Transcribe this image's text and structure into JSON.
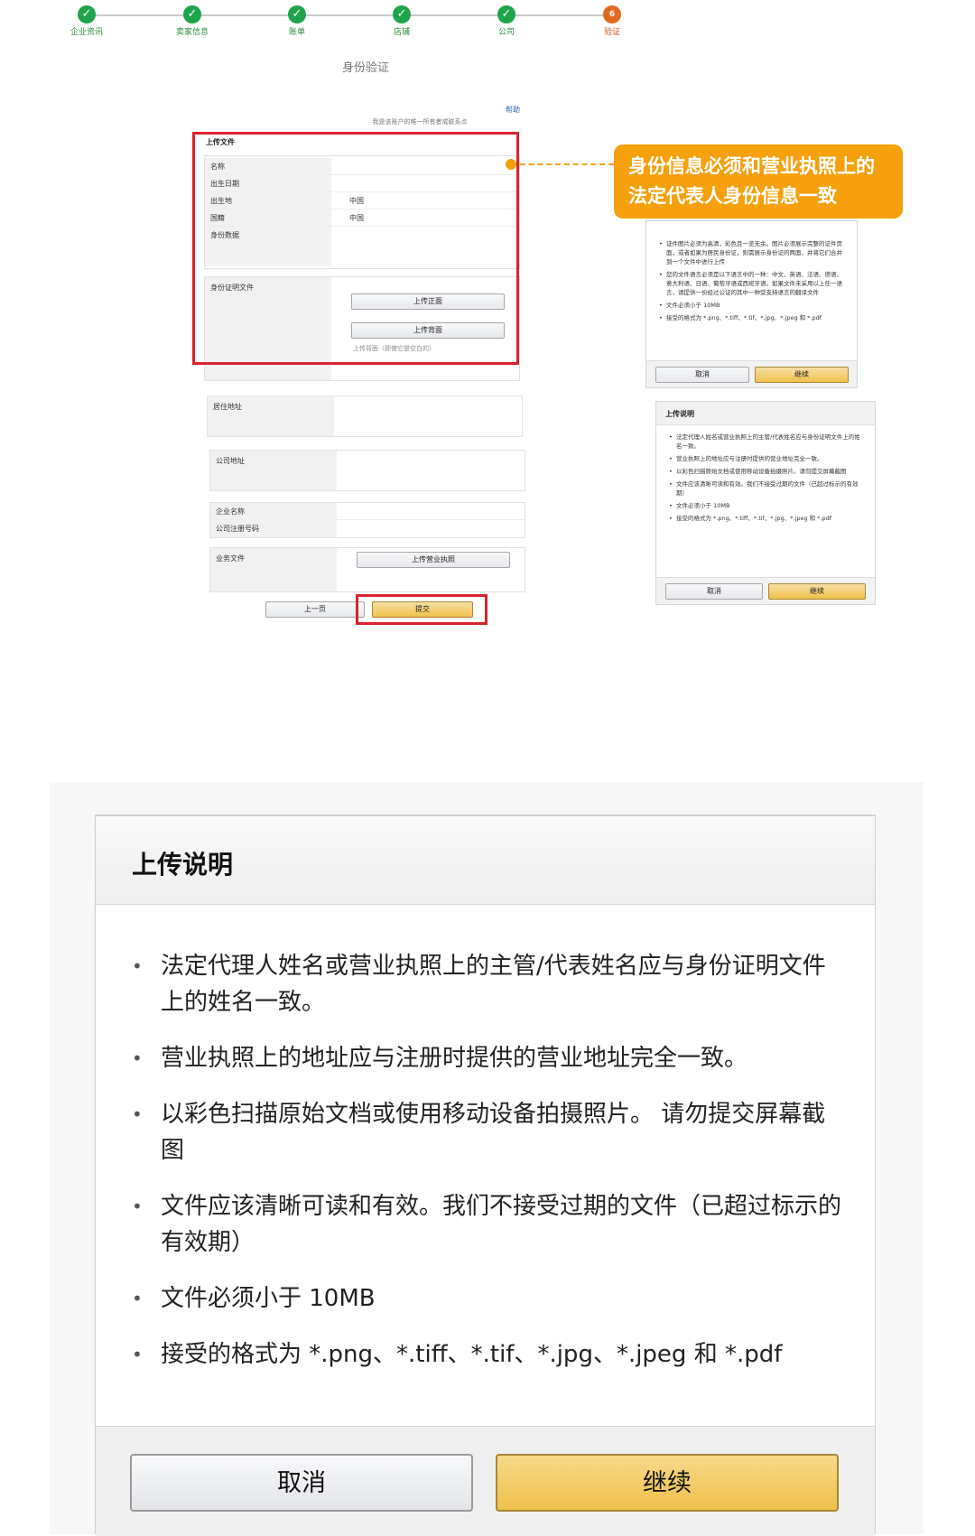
{
  "stepper": {
    "steps": [
      {
        "label": "企业资讯",
        "mark": "✓"
      },
      {
        "label": "卖家信息",
        "mark": "✓"
      },
      {
        "label": "账单",
        "mark": "✓"
      },
      {
        "label": "店铺",
        "mark": "✓"
      },
      {
        "label": "公司",
        "mark": "✓"
      },
      {
        "label": "验证",
        "mark": "6"
      }
    ],
    "done_color": "#1ea44b",
    "current_color": "#e1691f"
  },
  "verify": {
    "title": "身份验证",
    "help": "帮助",
    "contact": "我是该账户的唯一所有者或联系点"
  },
  "upload_section": {
    "title": "上传文件",
    "rows": [
      {
        "key": "名称",
        "value": ""
      },
      {
        "key": "出生日期",
        "value": ""
      },
      {
        "key": "出生地",
        "value": "中国"
      },
      {
        "key": "国籍",
        "value": "中国"
      },
      {
        "key": "身份数据",
        "value": ""
      }
    ],
    "id_doc_label": "身份证明文件",
    "front_button": "上传正面",
    "back_button": "上传背面",
    "back_note": "上传背面（即使它是空白的）"
  },
  "address": {
    "residence_label": "居住地址",
    "company_address_label": "公司地址",
    "company_name_label": "企业名称",
    "company_reg_label": "公司注册号码",
    "business_doc_label": "业务文件",
    "business_button": "上传营业执照"
  },
  "nav": {
    "prev": "上一页",
    "submit": "提交"
  },
  "callout": {
    "line1": "身份信息必须和营业执照上的",
    "line2": "法定代表人身份信息一致",
    "color": "#f5a00c"
  },
  "mini_dialog_top": {
    "items": [
      "证件图片必须为高清，彩色且一览无余。图片必须展示完整的证件页面，或者如果为居民身份证，则需展示身份证的两面，并将它们合并到一个文件中进行上传",
      "您的文件语言必须是以下语言中的一种：中文、英语、法语、德语、意大利语、日语、葡萄牙语或西班牙语。如果文件未采用以上任一语言，请提供一份经过公证的其中一种受支持语言的翻译文件",
      "文件必须小于 10MB",
      "接受的格式为 *.png、*.tiff、*.tif、*.jpg、*.jpeg 和 *.pdf"
    ],
    "cancel": "取消",
    "continue": "继续"
  },
  "mini_dialog_bottom": {
    "title": "上传说明",
    "items": [
      "法定代理人姓名或营业执照上的主管/代表姓名应与身份证明文件上的姓名一致。",
      "营业执照上的地址应与注册时提供的营业地址完全一致。",
      "以彩色扫描原始文档或使用移动设备拍摄照片。请勿提交屏幕截图",
      "文件应该清晰可读和有效。我们不接受过期的文件（已超过标示的有效期）",
      "文件必须小于 10MB",
      "接受的格式为 *.png、*.tiff、*.tif、*.jpg、*.jpeg 和 *.pdf"
    ],
    "cancel": "取消",
    "continue": "继续"
  },
  "big_dialog": {
    "title": "上传说明",
    "items": [
      "法定代理人姓名或营业执照上的主管/代表姓名应与身份证明文件上的姓名一致。",
      "营业执照上的地址应与注册时提供的营业地址完全一致。",
      "以彩色扫描原始文档或使用移动设备拍摄照片。 请勿提交屏幕截图",
      "文件应该清晰可读和有效。我们不接受过期的文件（已超过标示的有效期）",
      "文件必须小于 10MB",
      "接受的格式为 *.png、*.tiff、*.tif、*.jpg、*.jpeg 和 *.pdf"
    ],
    "cancel": "取消",
    "continue": "继续"
  }
}
